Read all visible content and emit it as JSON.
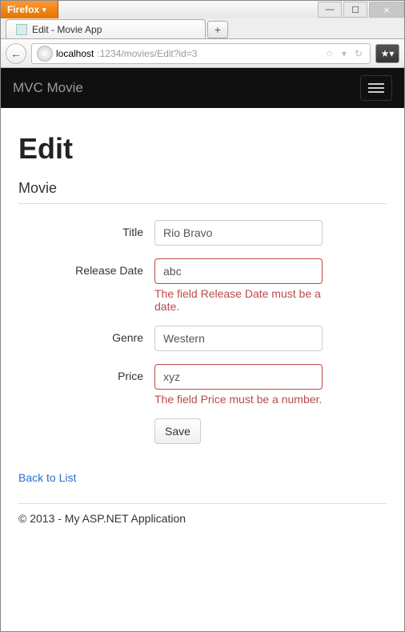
{
  "browser": {
    "app_name": "Firefox",
    "tab_title": "Edit - Movie App",
    "url_host": "localhost",
    "url_path": ":1234/movies/Edit?id=3",
    "new_tab_glyph": "+",
    "min_glyph": "—",
    "max_glyph": "☐",
    "close_glyph": "×",
    "back_glyph": "←",
    "star_glyph": "☆",
    "dropdown_glyph": "▾",
    "reload_glyph": "↻",
    "bookmark_glyph": "★▾"
  },
  "navbar": {
    "brand": "MVC Movie"
  },
  "page": {
    "heading": "Edit",
    "subheading": "Movie"
  },
  "form": {
    "title": {
      "label": "Title",
      "value": "Rio Bravo",
      "error": ""
    },
    "release_date": {
      "label": "Release Date",
      "value": "abc",
      "error": "The field Release Date must be a date."
    },
    "genre": {
      "label": "Genre",
      "value": "Western",
      "error": ""
    },
    "price": {
      "label": "Price",
      "value": "xyz",
      "error": "The field Price must be a number."
    },
    "save_label": "Save"
  },
  "back_link": "Back to List",
  "footer": "© 2013 - My ASP.NET Application"
}
